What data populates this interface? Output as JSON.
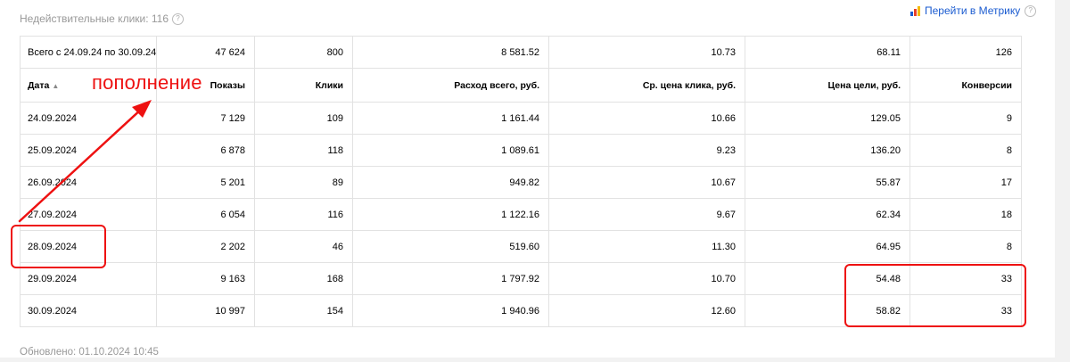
{
  "top_note": {
    "label": "Недействительные клики: 116",
    "help": "?"
  },
  "metrika_link": {
    "label": "Перейти в Метрику",
    "help": "?"
  },
  "table": {
    "totals": [
      "Всего с 24.09.24 по 30.09.24",
      "47 624",
      "800",
      "8 581.52",
      "10.73",
      "68.11",
      "126"
    ],
    "headers": [
      "Дата",
      "Показы",
      "Клики",
      "Расход всего, руб.",
      "Ср. цена клика, руб.",
      "Цена цели, руб.",
      "Конверсии"
    ],
    "sort_indicator": "▲",
    "rows": [
      [
        "24.09.2024",
        "7 129",
        "109",
        "1 161.44",
        "10.66",
        "129.05",
        "9"
      ],
      [
        "25.09.2024",
        "6 878",
        "118",
        "1 089.61",
        "9.23",
        "136.20",
        "8"
      ],
      [
        "26.09.2024",
        "5 201",
        "89",
        "949.82",
        "10.67",
        "55.87",
        "17"
      ],
      [
        "27.09.2024",
        "6 054",
        "116",
        "1 122.16",
        "9.67",
        "62.34",
        "18"
      ],
      [
        "28.09.2024",
        "2 202",
        "46",
        "519.60",
        "11.30",
        "64.95",
        "8"
      ],
      [
        "29.09.2024",
        "9 163",
        "168",
        "1 797.92",
        "10.70",
        "54.48",
        "33"
      ],
      [
        "30.09.2024",
        "10 997",
        "154",
        "1 940.96",
        "12.60",
        "58.82",
        "33"
      ]
    ]
  },
  "updated": "Обновлено: 01.10.2024 10:45",
  "annotation": {
    "text": "пополнение",
    "color": "#ee1111"
  }
}
